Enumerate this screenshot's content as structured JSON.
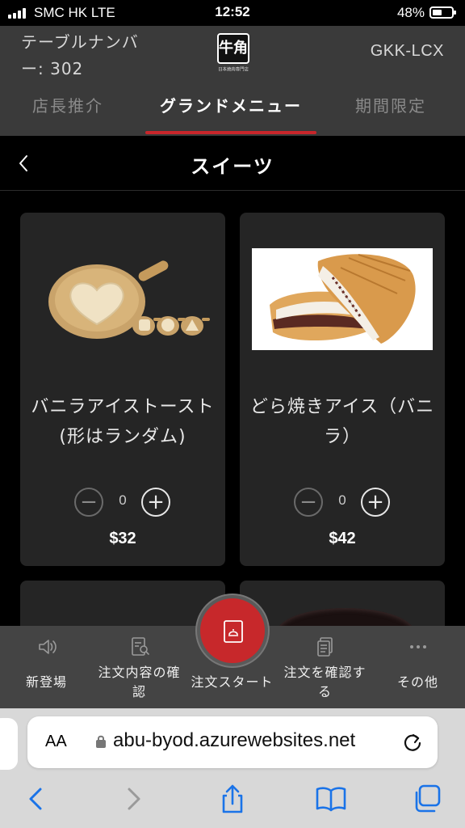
{
  "status": {
    "carrier": "SMC HK  LTE",
    "time": "12:52",
    "battery": "48%",
    "battery_level": 0.48
  },
  "header": {
    "table_label": "テーブルナンバー: 302",
    "logo_text": "牛角",
    "logo_sub": "日本焼肉専門店",
    "code": "GKK-LCX",
    "tabs": [
      {
        "label": "店長推介",
        "active": false
      },
      {
        "label": "グランドメニュー",
        "active": true
      },
      {
        "label": "期間限定",
        "active": false
      }
    ]
  },
  "category": {
    "title": "スイーツ",
    "back_icon": "chevron-left-icon"
  },
  "products": [
    {
      "name": "バニラアイストースト(形はランダム)",
      "qty": "0",
      "price": "$32",
      "minus": "−",
      "plus": "+"
    },
    {
      "name": "どら焼きアイス（バニラ）",
      "qty": "0",
      "price": "$42",
      "minus": "−",
      "plus": "+"
    }
  ],
  "bottom_nav": {
    "items": [
      {
        "label": "新登場",
        "icon": "speaker-icon"
      },
      {
        "label": "注文内容の確認",
        "icon": "order-review-icon"
      },
      {
        "label": "注文スタート",
        "icon": "order-start-icon"
      },
      {
        "label": "注文を確認する",
        "icon": "documents-icon"
      },
      {
        "label": "その他",
        "icon": "more-icon"
      }
    ]
  },
  "browser": {
    "aa_label": "AA",
    "url": "abu-byod.azurewebsites.net",
    "accent": "#1a73e8"
  },
  "colors": {
    "accent_red": "#c8262b",
    "header_bg": "#3a3a3a",
    "card_bg": "#252525"
  }
}
